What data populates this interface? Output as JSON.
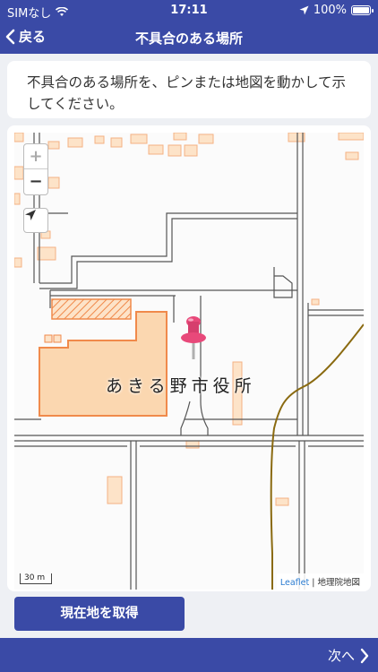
{
  "status_bar": {
    "carrier": "SIMなし",
    "time": "17:11",
    "battery": "100%"
  },
  "nav": {
    "back_label": "戻る",
    "title": "不具合のある場所"
  },
  "instruction": {
    "text": "不具合のある場所を、ピンまたは地図を動かして示してください。"
  },
  "map": {
    "zoom_in": "+",
    "zoom_out": "−",
    "building_label": "あきる野市役所",
    "scale": "30 m",
    "attribution_link": "Leaflet",
    "attribution_separator": " | ",
    "attribution_source": "地理院地図",
    "pin_color": "#e8497a"
  },
  "actions": {
    "get_location": "現在地を取得",
    "next": "次へ"
  },
  "colors": {
    "primary": "#3a4aa6",
    "building_fill": "#fbd7b0",
    "building_stroke": "#f08a4b",
    "road": "#555555",
    "river": "#8a6a10"
  }
}
